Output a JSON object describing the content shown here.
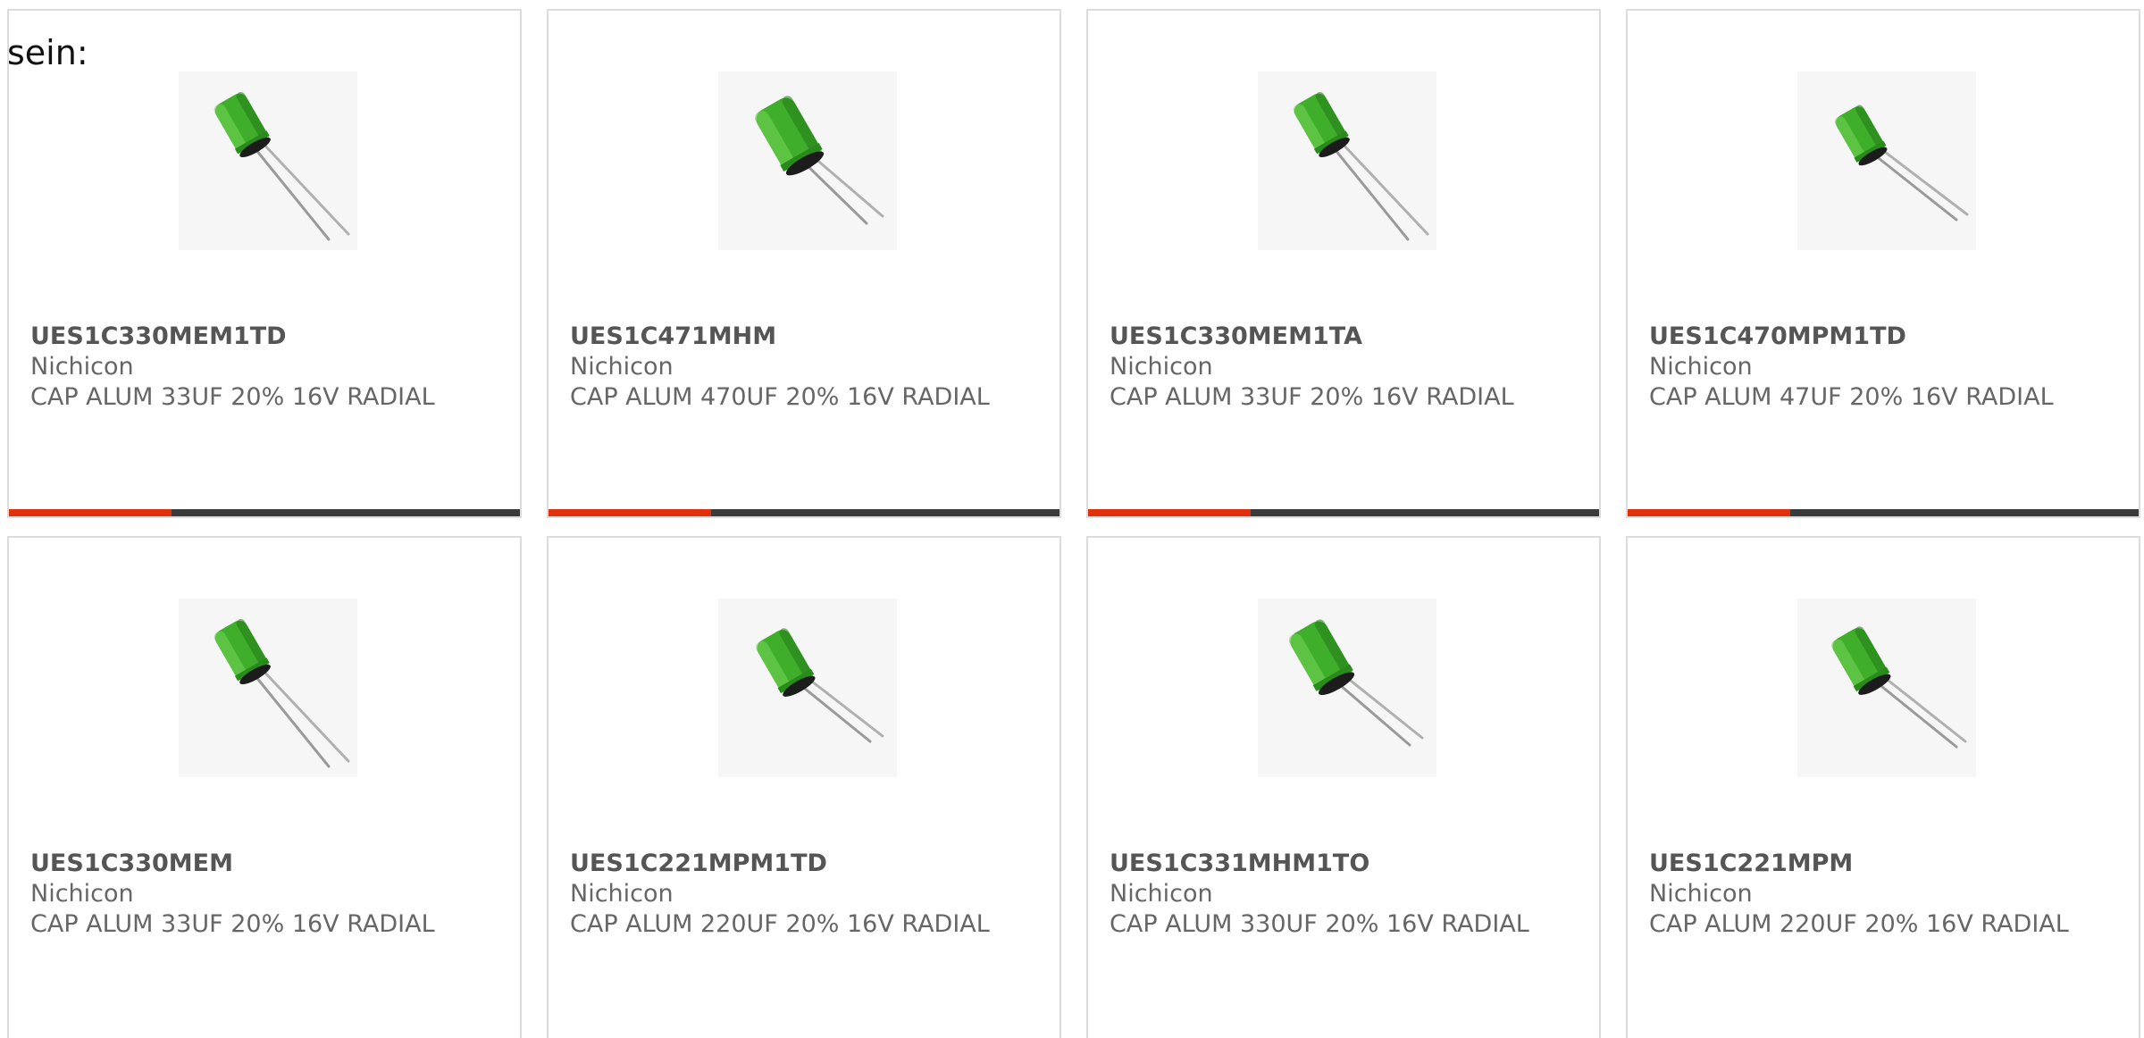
{
  "intro_text": "sein:",
  "colors": {
    "accent": "#e0310c",
    "bar_dark": "#3a3a3a",
    "capacitor_green": "#3fae2a",
    "border": "#dcdcdc",
    "text": "#666666"
  },
  "products": [
    {
      "part_number": "UES1C330MEM1TD",
      "manufacturer": "Nichicon",
      "description": "CAP ALUM 33UF 20% 16V RADIAL",
      "icon": "capacitor-icon"
    },
    {
      "part_number": "UES1C471MHM",
      "manufacturer": "Nichicon",
      "description": "CAP ALUM 470UF 20% 16V RADIAL",
      "icon": "capacitor-icon"
    },
    {
      "part_number": "UES1C330MEM1TA",
      "manufacturer": "Nichicon",
      "description": "CAP ALUM 33UF 20% 16V RADIAL",
      "icon": "capacitor-icon"
    },
    {
      "part_number": "UES1C470MPM1TD",
      "manufacturer": "Nichicon",
      "description": "CAP ALUM 47UF 20% 16V RADIAL",
      "icon": "capacitor-icon"
    },
    {
      "part_number": "UES1C330MEM",
      "manufacturer": "Nichicon",
      "description": "CAP ALUM 33UF 20% 16V RADIAL",
      "icon": "capacitor-icon"
    },
    {
      "part_number": "UES1C221MPM1TD",
      "manufacturer": "Nichicon",
      "description": "CAP ALUM 220UF 20% 16V RADIAL",
      "icon": "capacitor-icon"
    },
    {
      "part_number": "UES1C331MHM1TO",
      "manufacturer": "Nichicon",
      "description": "CAP ALUM 330UF 20% 16V RADIAL",
      "icon": "capacitor-icon"
    },
    {
      "part_number": "UES1C221MPM",
      "manufacturer": "Nichicon",
      "description": "CAP ALUM 220UF 20% 16V RADIAL",
      "icon": "capacitor-icon"
    }
  ]
}
